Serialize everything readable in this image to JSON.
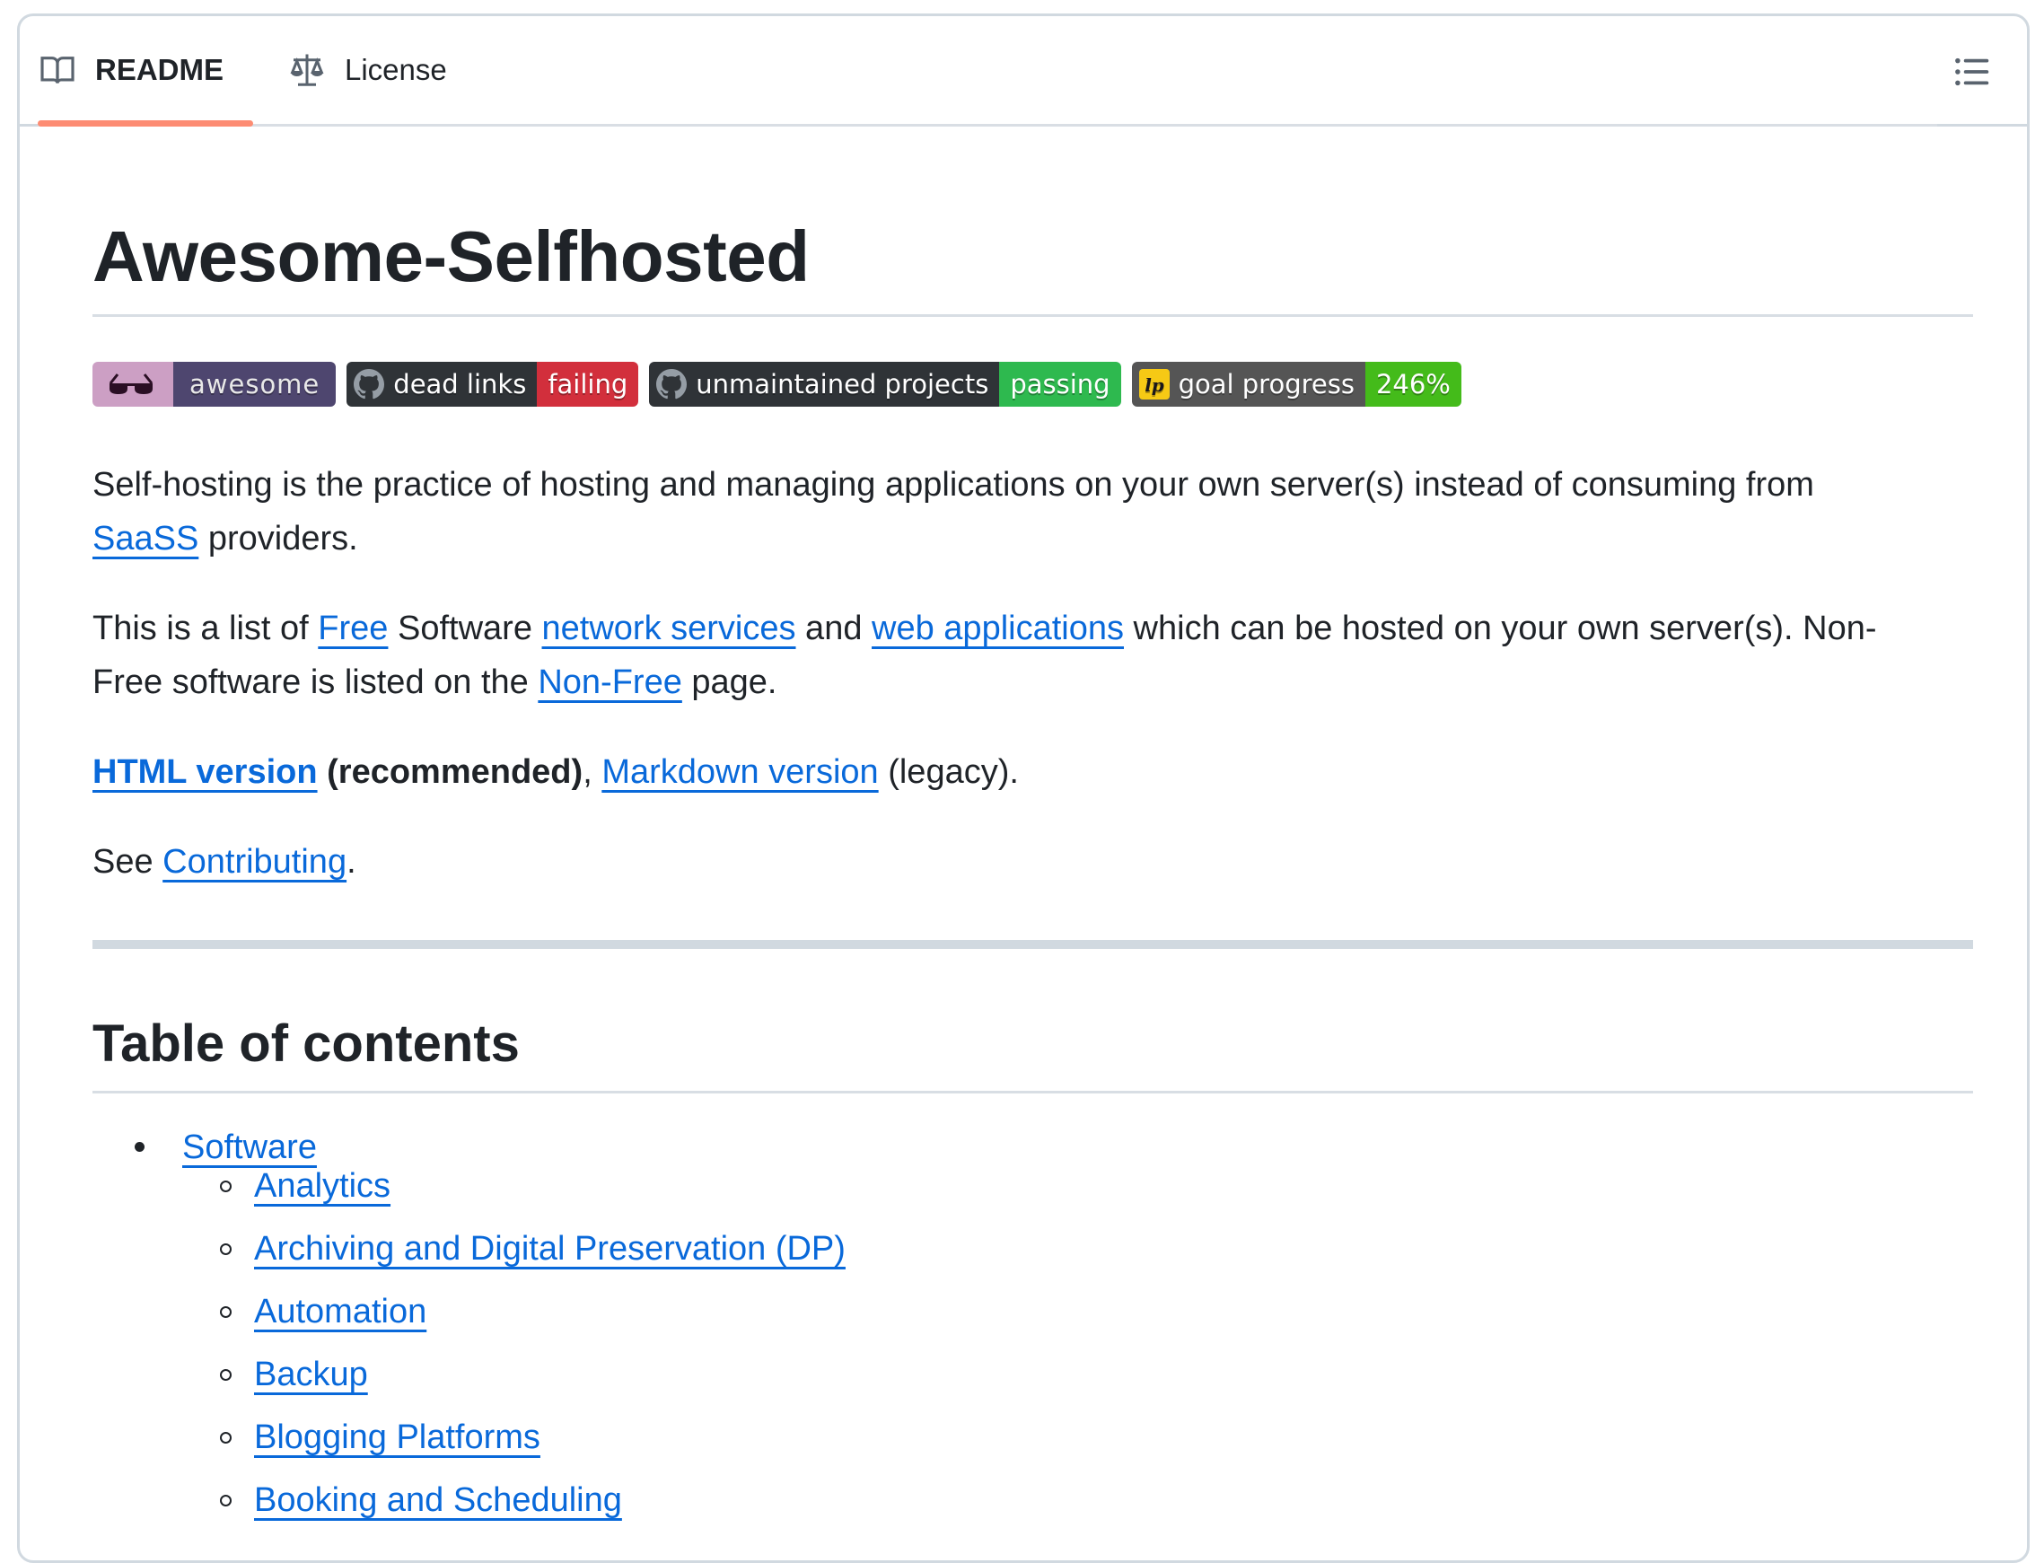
{
  "tabs": [
    {
      "label": "README",
      "icon": "book-icon",
      "active": true
    },
    {
      "label": "License",
      "icon": "law-scale-icon",
      "active": false
    }
  ],
  "toc_button": {
    "icon": "list-unordered-icon"
  },
  "title": "Awesome-Selfhosted",
  "badges": [
    {
      "left": "",
      "right": "awesome",
      "left_icon": "sunglasses-icon",
      "left_color": "#cc9fc4",
      "right_color": "#4e466f"
    },
    {
      "left": "dead links",
      "right": "failing",
      "left_icon": "github-icon",
      "left_color": "#2f3337",
      "right_color": "#d22f3c"
    },
    {
      "left": "unmaintained projects",
      "right": "passing",
      "left_icon": "github-icon",
      "left_color": "#2f3337",
      "right_color": "#2eb94f"
    },
    {
      "left": "goal progress",
      "right": "246%",
      "left_icon": "liberapay-icon",
      "left_color": "#555555",
      "right_color": "#44bb1a"
    }
  ],
  "intro": {
    "p1": {
      "t1": "Self-hosting is the practice of hosting and managing applications on your own server(s) instead of consuming from",
      "link": "SaaSS",
      "t2": " providers."
    },
    "p2": {
      "t1": "This is a list of ",
      "l1": "Free",
      "t2": " Software ",
      "l2": "network services",
      "t3": " and ",
      "l3": "web applications",
      "t4": " which can be hosted on your own server(s). Non-",
      "t5": "Free software is listed on the ",
      "l4": "Non-Free",
      "t6": " page."
    },
    "p3": {
      "l1": "HTML version",
      "t1": " (recommended)",
      "t2": ", ",
      "l2": "Markdown version",
      "t3": " (legacy)."
    },
    "p4": {
      "t1": "See ",
      "l1": "Contributing",
      "t2": "."
    }
  },
  "toc": {
    "heading": "Table of contents",
    "top": "Software",
    "items": [
      "Analytics",
      "Archiving and Digital Preservation (DP)",
      "Automation",
      "Backup",
      "Blogging Platforms",
      "Booking and Scheduling"
    ]
  }
}
